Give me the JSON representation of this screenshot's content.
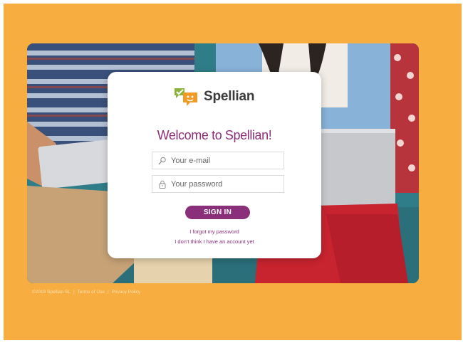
{
  "app": {
    "name": "Spellian"
  },
  "login": {
    "welcome": "Welcome to Spellian!",
    "email_placeholder": "Your e-mail",
    "password_placeholder": "Your password",
    "signin_label": "SIGN IN",
    "forgot_link": "I forgot my password",
    "no_account_link": "I don't think I have an account yet"
  },
  "footer": {
    "copyright": "©2019 Spellian SL",
    "separator": "|",
    "terms": "Terms of Use",
    "privacy": "Privacy Policy"
  },
  "colors": {
    "background": "#F7AD3F",
    "accent": "#8a2f7a",
    "logo_green": "#8cb43c",
    "logo_orange": "#f29a26"
  },
  "icons": {
    "email": "user-icon",
    "password": "lock-icon",
    "logo": "speech-bubbles-icon"
  }
}
